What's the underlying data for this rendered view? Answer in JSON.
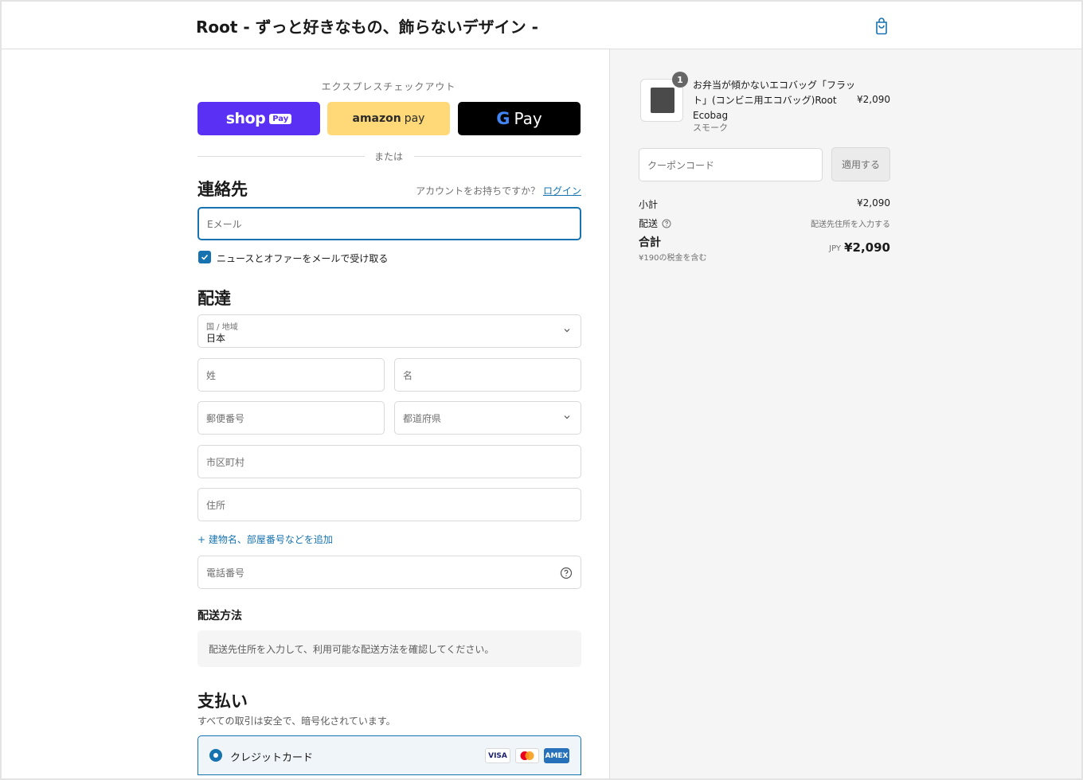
{
  "header": {
    "store_title": "Root - ずっと好きなもの、飾らないデザイン -",
    "cart_icon": "shopping-bag-icon"
  },
  "express": {
    "title": "エクスプレスチェックアウト",
    "shop_pay": {
      "word": "shop",
      "badge": "Pay",
      "color": "#5a31f4"
    },
    "amazon_pay": {
      "word": "amazon",
      "pay": "pay",
      "color": "#ffd978"
    },
    "google_pay": {
      "g": "G",
      "word": "Pay",
      "color": "#000000"
    },
    "or": "または"
  },
  "contact": {
    "heading": "連絡先",
    "account_prompt": "アカウントをお持ちですか？",
    "login": "ログイン",
    "email_placeholder": "Eメール",
    "newsletter_label": "ニュースとオファーをメールで受け取る",
    "newsletter_checked": true
  },
  "delivery": {
    "heading": "配達",
    "country_label": "国 / 地域",
    "country_value": "日本",
    "last_name": "姓",
    "first_name": "名",
    "postal_code": "郵便番号",
    "prefecture": "都道府県",
    "city": "市区町村",
    "address": "住所",
    "add_building": "+ 建物名、部屋番号などを追加",
    "phone": "電話番号"
  },
  "shipping_method": {
    "heading": "配送方法",
    "note": "配送先住所を入力して、利用可能な配送方法を確認してください。"
  },
  "payment": {
    "heading": "支払い",
    "secure_note": "すべての取引は安全で、暗号化されています。",
    "credit_card_label": "クレジットカード",
    "cards": [
      "VISA",
      "mastercard",
      "AMEX"
    ]
  },
  "summary": {
    "product": {
      "quantity": "1",
      "name": "お弁当が傾かないエコバッグ「フラット」(コンビニ用エコバッグ)Root Ecobag",
      "variant": "スモーク",
      "price": "¥2,090"
    },
    "coupon_placeholder": "クーポンコード",
    "apply_label": "適用する",
    "subtotal_label": "小計",
    "subtotal_value": "¥2,090",
    "shipping_label": "配送",
    "shipping_value": "配送先住所を入力する",
    "total_label": "合計",
    "tax_note": "¥190の税金を含む",
    "currency": "JPY",
    "total_value": "¥2,090"
  },
  "colors": {
    "accent": "#1773b0",
    "summary_bg": "#f5f5f5"
  }
}
